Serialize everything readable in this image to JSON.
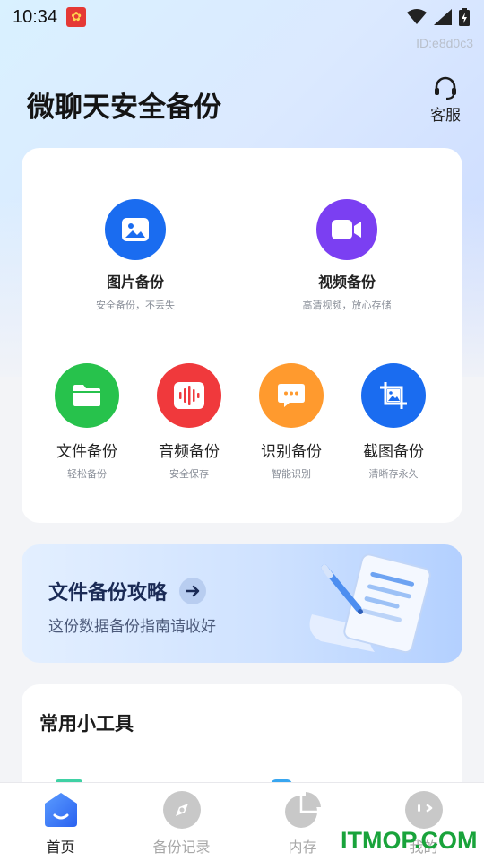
{
  "status_bar": {
    "time": "10:34"
  },
  "device_id": "ID:e8d0c3",
  "header": {
    "title": "微聊天安全备份",
    "service_label": "客服"
  },
  "main_features": [
    {
      "label": "图片备份",
      "sub": "安全备份，不丢失",
      "icon": "image-icon",
      "color": "#1a6cf0"
    },
    {
      "label": "视频备份",
      "sub": "高清视频，放心存储",
      "icon": "video-icon",
      "color": "#7b3ff2"
    }
  ],
  "quick_features": [
    {
      "label": "文件备份",
      "sub": "轻松备份",
      "icon": "folder-icon",
      "color": "#27c24c"
    },
    {
      "label": "音频备份",
      "sub": "安全保存",
      "icon": "audio-wave-icon",
      "color": "#f0393c"
    },
    {
      "label": "识别备份",
      "sub": "智能识别",
      "icon": "chat-bubble-icon",
      "color": "#ff9a2e"
    },
    {
      "label": "截图备份",
      "sub": "清晰存永久",
      "icon": "crop-icon",
      "color": "#1a6cf0"
    }
  ],
  "banner": {
    "title": "文件备份攻略",
    "subtitle": "这份数据备份指南请收好"
  },
  "tools": {
    "title": "常用小工具"
  },
  "bottom_nav": [
    {
      "label": "首页",
      "icon": "home-icon",
      "active": true
    },
    {
      "label": "备份记录",
      "icon": "compass-icon",
      "active": false
    },
    {
      "label": "内存",
      "icon": "pie-chart-icon",
      "active": false
    },
    {
      "label": "我的",
      "icon": "profile-icon",
      "active": false
    }
  ],
  "watermark": "ITMOP.COM"
}
